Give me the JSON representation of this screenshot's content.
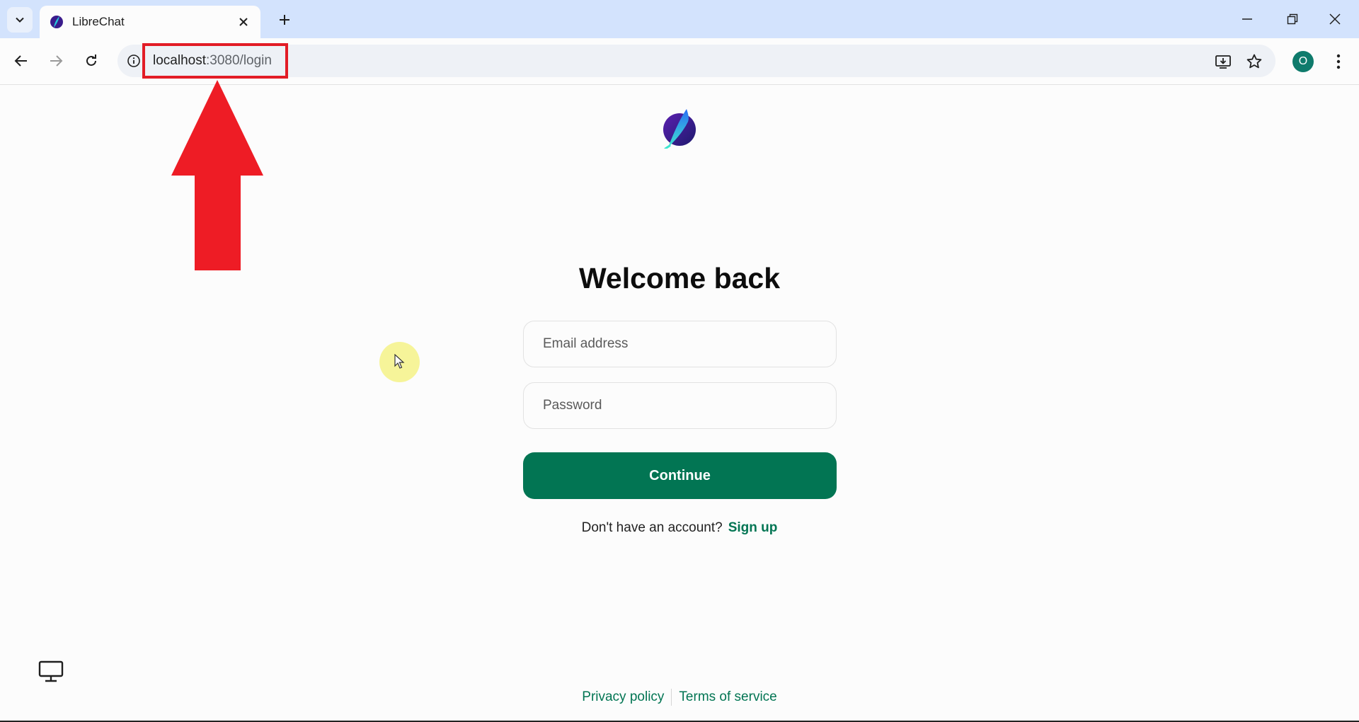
{
  "browser": {
    "tab_title": "LibreChat",
    "url_host": "localhost",
    "url_rest": ":3080/login",
    "profile_initial": "O"
  },
  "login": {
    "heading": "Welcome back",
    "email_placeholder": "Email address",
    "password_placeholder": "Password",
    "continue_label": "Continue",
    "signup_prompt": "Don't have an account?",
    "signup_link": "Sign up"
  },
  "footer": {
    "privacy": "Privacy policy",
    "terms": "Terms of service"
  },
  "colors": {
    "brand_green": "#027553",
    "annotation_red": "#e21c26",
    "tabstrip": "#d3e3fd"
  },
  "icons": [
    "chevron-down-icon",
    "close-icon",
    "plus-icon",
    "minimize-icon",
    "restore-icon",
    "back-icon",
    "forward-icon",
    "reload-icon",
    "info-icon",
    "install-app-icon",
    "star-icon",
    "kebab-menu-icon",
    "monitor-icon"
  ]
}
